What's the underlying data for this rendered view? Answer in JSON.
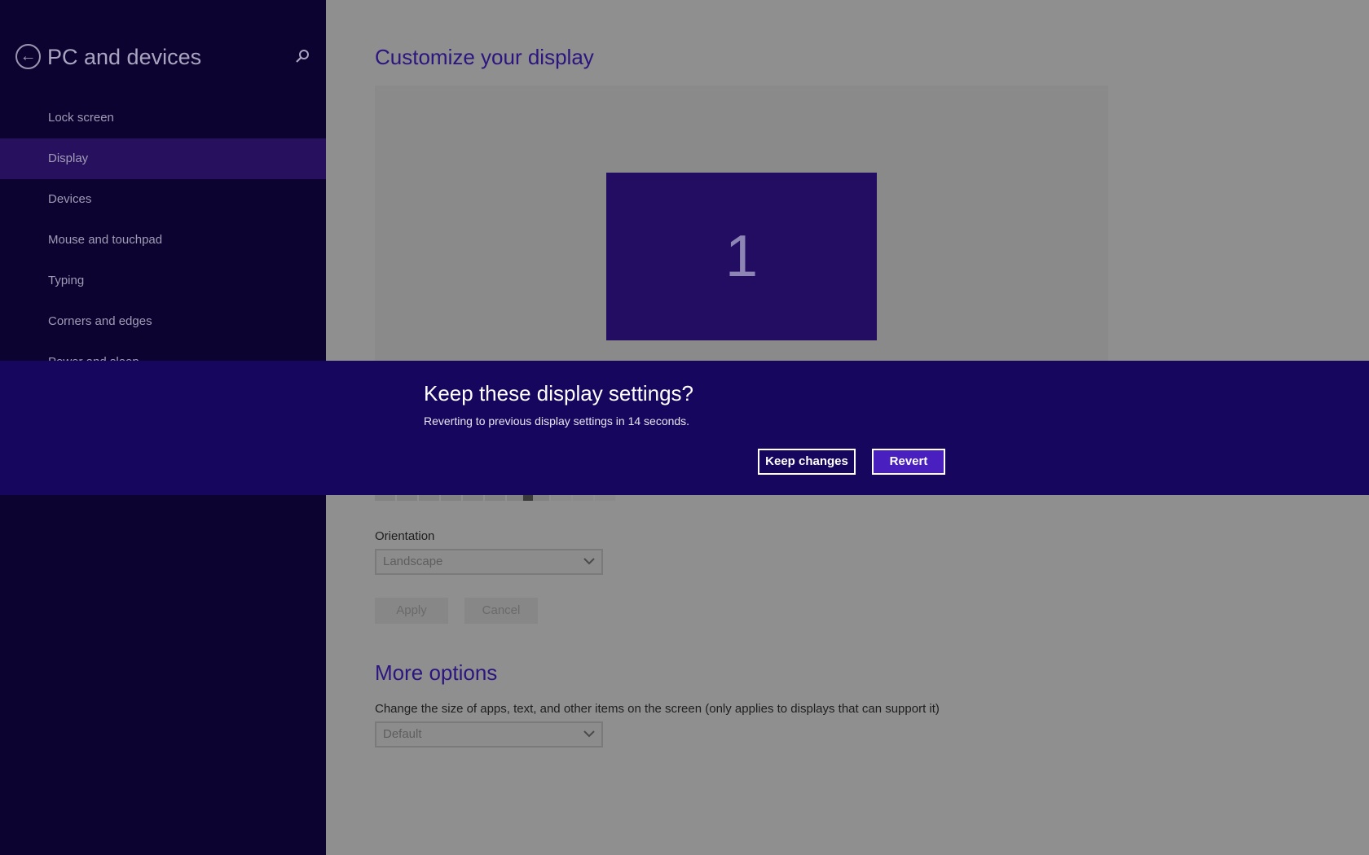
{
  "sidebar": {
    "title": "PC and devices",
    "back_icon": "back-arrow-icon",
    "search_icon": "search-icon",
    "items": [
      {
        "label": "Lock screen",
        "selected": false
      },
      {
        "label": "Display",
        "selected": true
      },
      {
        "label": "Devices",
        "selected": false
      },
      {
        "label": "Mouse and touchpad",
        "selected": false
      },
      {
        "label": "Typing",
        "selected": false
      },
      {
        "label": "Corners and edges",
        "selected": false
      },
      {
        "label": "Power and sleep",
        "selected": false
      }
    ]
  },
  "main": {
    "title": "Customize your display",
    "monitor_number": "1",
    "orientation": {
      "label": "Orientation",
      "value": "Landscape"
    },
    "apply_label": "Apply",
    "cancel_label": "Cancel",
    "more_options": {
      "title": "More options",
      "description": "Change the size of apps, text, and other items on the screen (only applies to displays that can support it)",
      "value": "Default"
    }
  },
  "dialog": {
    "title": "Keep these display settings?",
    "message": "Reverting to previous display settings in 14 seconds.",
    "keep_label": "Keep changes",
    "revert_label": "Revert"
  },
  "colors": {
    "sidebar_bg": "#0c0330",
    "accent": "#4a1fbf",
    "banner_bg": "#17065d",
    "monitor_fill": "#230d63"
  }
}
